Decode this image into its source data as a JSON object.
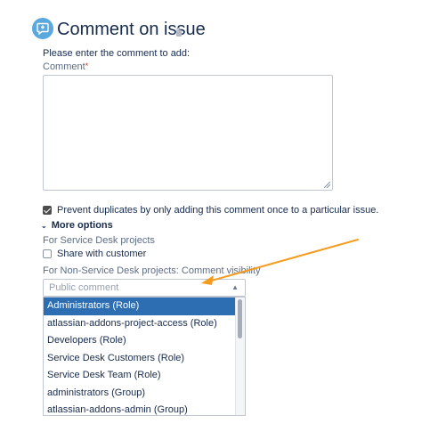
{
  "header": {
    "title": "Comment on issue",
    "icon": "comment-plus-icon",
    "accent": "#5aa8dd"
  },
  "form": {
    "intro": "Please enter the comment to add:",
    "comment_label": "Comment",
    "required_mark": "*",
    "comment_value": "",
    "prevent_duplicates": {
      "label": "Prevent duplicates by only adding this comment once to a particular issue.",
      "checked": true
    },
    "more_options": "More options",
    "service_desk_label": "For Service Desk projects",
    "share_with_customer": {
      "label": "Share with customer",
      "checked": false
    },
    "non_service_desk_label": "For Non-Service Desk projects: Comment visibility",
    "visibility": {
      "placeholder": "Public comment",
      "options": [
        "Administrators (Role)",
        "atlassian-addons-project-access (Role)",
        "Developers (Role)",
        "Service Desk Customers (Role)",
        "Service Desk Team (Role)",
        "administrators (Group)",
        "atlassian-addons-admin (Group)"
      ],
      "highlighted": "Administrators (Role)",
      "highlight_color": "#2d6eb2"
    }
  },
  "annotation": {
    "color": "#f39c1f"
  }
}
